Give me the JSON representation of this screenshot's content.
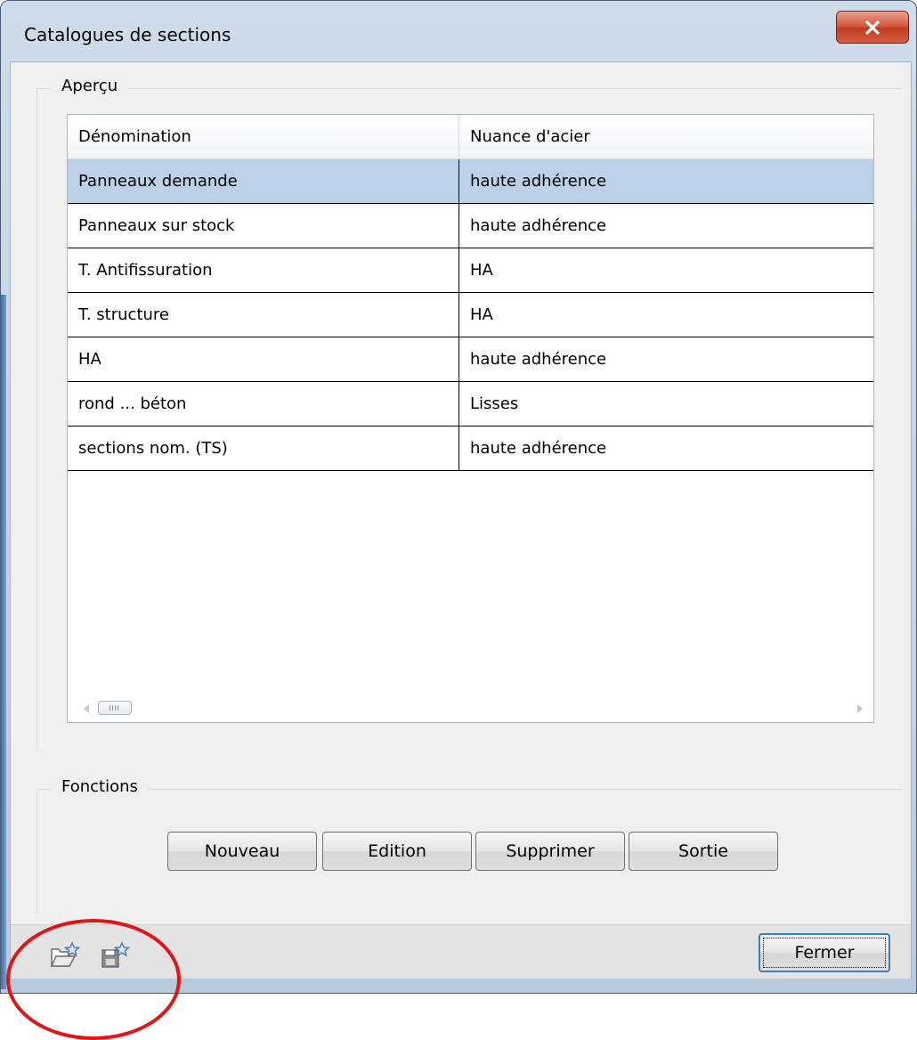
{
  "window": {
    "title": "Catalogues de sections",
    "close_label": "X"
  },
  "apercu": {
    "label": "Aperçu",
    "table": {
      "columns": [
        "Dénomination",
        "Nuance d'acier"
      ],
      "rows": [
        {
          "name": "Panneaux demande",
          "steel": "haute adhérence",
          "selected": true
        },
        {
          "name": "Panneaux sur stock",
          "steel": "haute adhérence"
        },
        {
          "name": "T. Antifissuration",
          "steel": "HA"
        },
        {
          "name": "T. structure",
          "steel": "HA"
        },
        {
          "name": "HA",
          "steel": "haute adhérence"
        },
        {
          "name": "rond ... béton",
          "steel": "Lisses"
        },
        {
          "name": "sections nom. (TS)",
          "steel": "haute adhérence"
        }
      ]
    }
  },
  "fonctions": {
    "label": "Fonctions",
    "buttons": [
      "Nouveau",
      "Edition",
      "Supprimer",
      "Sortie"
    ]
  },
  "footer": {
    "icons": [
      "open-favorite-icon",
      "save-favorite-icon"
    ],
    "close_button": "Fermer"
  },
  "colors": {
    "selection": "#bcd0e8",
    "annotation": "#e01515"
  }
}
